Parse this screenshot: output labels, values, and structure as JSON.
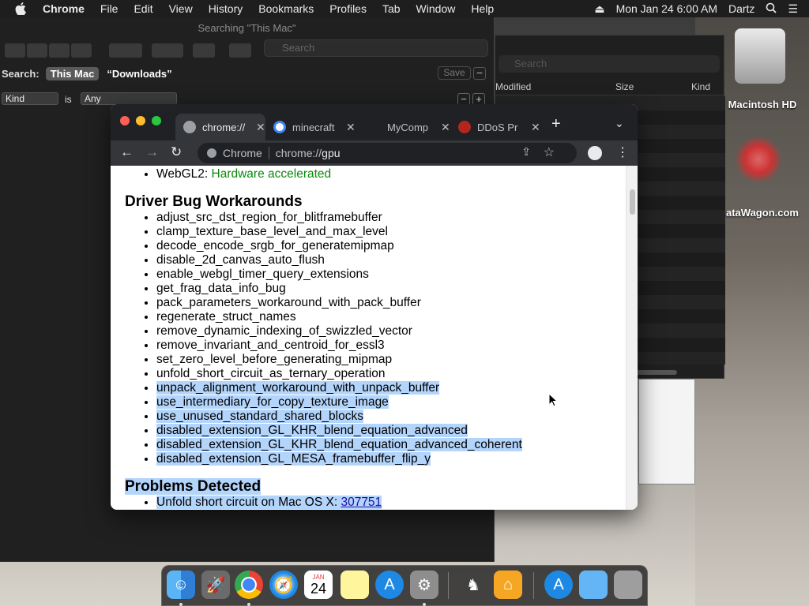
{
  "menubar": {
    "app": "Chrome",
    "items": [
      "File",
      "Edit",
      "View",
      "History",
      "Bookmarks",
      "Profiles",
      "Tab",
      "Window",
      "Help"
    ],
    "datetime": "Mon Jan 24  6:00 AM",
    "user": "Dartz"
  },
  "desktop": {
    "hd_label": "Macintosh HD",
    "datawagon_label": "ataWagon.com"
  },
  "finder": {
    "title": "Searching \"This Mac\"",
    "search_placeholder": "Search",
    "search_label": "Search:",
    "scope_this_mac": "This Mac",
    "scope_folder": "“Downloads”",
    "save_label": "Save",
    "criteria_attr": "Kind",
    "criteria_is": "is",
    "criteria_value": "Any"
  },
  "finder2": {
    "search_placeholder": "Search",
    "col_modified": "Modified",
    "col_size": "Size",
    "col_kind": "Kind"
  },
  "chrome": {
    "tabs": [
      {
        "title": "chrome://",
        "fav_color": "#9aa0a6"
      },
      {
        "title": "minecraft",
        "fav_color": "#4285f4"
      },
      {
        "title": "MyComp",
        "fav_color": "#202124"
      },
      {
        "title": "DDoS Pr",
        "fav_color": "#b3261e"
      }
    ],
    "omnibox_site": "Chrome",
    "omnibox_url_prefix": "chrome://",
    "omnibox_url_host": "gpu"
  },
  "page": {
    "webgl2_label": "WebGL2: ",
    "webgl2_value": "Hardware accelerated",
    "driver_heading": "Driver Bug Workarounds",
    "workarounds": [
      "adjust_src_dst_region_for_blitframebuffer",
      "clamp_texture_base_level_and_max_level",
      "decode_encode_srgb_for_generatemipmap",
      "disable_2d_canvas_auto_flush",
      "enable_webgl_timer_query_extensions",
      "get_frag_data_info_bug",
      "pack_parameters_workaround_with_pack_buffer",
      "regenerate_struct_names",
      "remove_dynamic_indexing_of_swizzled_vector",
      "remove_invariant_and_centroid_for_essl3",
      "set_zero_level_before_generating_mipmap",
      "unfold_short_circuit_as_ternary_operation",
      "unpack_alignment_workaround_with_unpack_buffer",
      "use_intermediary_for_copy_texture_image",
      "use_unused_standard_shared_blocks",
      "disabled_extension_GL_KHR_blend_equation_advanced",
      "disabled_extension_GL_KHR_blend_equation_advanced_coherent",
      "disabled_extension_GL_MESA_framebuffer_flip_y"
    ],
    "problems_heading": "Problems Detected",
    "problem_text": "Unfold short circuit on Mac OS X: ",
    "problem_link": "307751"
  },
  "dock": {
    "calendar_month": "JAN",
    "calendar_day": "24"
  }
}
